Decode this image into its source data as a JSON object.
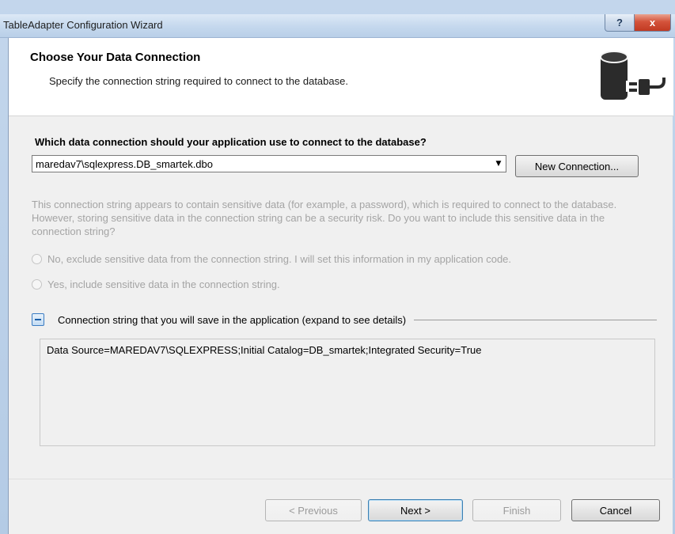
{
  "window": {
    "title": "TableAdapter Configuration Wizard",
    "help_glyph": "?",
    "close_glyph": "x"
  },
  "header": {
    "title": "Choose Your Data Connection",
    "subtitle": "Specify the connection string required to connect to the database.",
    "icon": "database-plug-icon"
  },
  "connection": {
    "question": "Which data connection should your application use to connect to the database?",
    "selected": "maredav7\\sqlexpress.DB_smartek.dbo",
    "new_connection_label": "New Connection..."
  },
  "sensitive": {
    "warning": "This connection string appears to contain sensitive data (for example, a password), which is required to connect to the database. However, storing sensitive data in the connection string can be a security risk. Do you want to include this sensitive data in the connection string?",
    "option_no": "No, exclude sensitive data from the connection string. I will set this information in my application code.",
    "option_yes": "Yes, include sensitive data in the connection string."
  },
  "details": {
    "expander_label": "Connection string that you will save in the application (expand to see details)",
    "connection_string": "Data Source=MAREDAV7\\SQLEXPRESS;Initial Catalog=DB_smartek;Integrated Security=True"
  },
  "footer": {
    "previous": "< Previous",
    "next": "Next >",
    "finish": "Finish",
    "cancel": "Cancel"
  },
  "colors": {
    "disabled_text": "#a4a4a4",
    "close_button": "#c13a22",
    "accent_border": "#3c7fb1"
  }
}
